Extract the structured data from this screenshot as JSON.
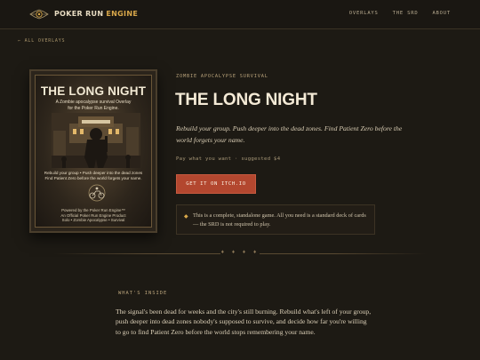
{
  "header": {
    "brand_primary": "POKER RUN",
    "brand_accent": "ENGINE",
    "nav": [
      "OVERLAYS",
      "THE SRD",
      "ABOUT"
    ]
  },
  "back_link": "← ALL OVERLAYS",
  "cover": {
    "title": "THE LONG NIGHT",
    "subtitle_line1": "A Zombie apocalypse survival Overlay",
    "subtitle_line2": "for the Poker Run Engine.",
    "blurb_line1": "Rebuild your group • Push deeper into the dead zones",
    "blurb_line2": "Find Patient Zero before the world forgets your name.",
    "footer_line1": "Powered by the Poker Run Engine™",
    "footer_line2": "An Official Poker Run Engine Product",
    "footer_line3": "Solo • Zombie Apocalypse • Survival"
  },
  "product": {
    "eyebrow": "ZOMBIE APOCALYPSE SURVIVAL",
    "title": "THE LONG NIGHT",
    "tagline": "Rebuild your group. Push deeper into the dead zones. Find Patient Zero before the world forgets your name.",
    "price": "Pay what you want · suggested $4",
    "cta_label": "GET IT ON ITCH.IO",
    "notice": "This is a complete, standalone game. All you need is a standard deck of cards — the SRD is not required to play."
  },
  "divider": "♦ ♦ ♦ ♦",
  "inside": {
    "label": "WHAT'S INSIDE",
    "text": "The signal's been dead for weeks and the city's still burning. Rebuild what's left of your group, push deeper into dead zones nobody's supposed to survive, and decide how far you're willing to go to find Patient Zero before the world stops remembering your name."
  },
  "colors": {
    "background": "#1d1a14",
    "accent_gold": "#d9a84a",
    "cta_red": "#b3472f"
  }
}
